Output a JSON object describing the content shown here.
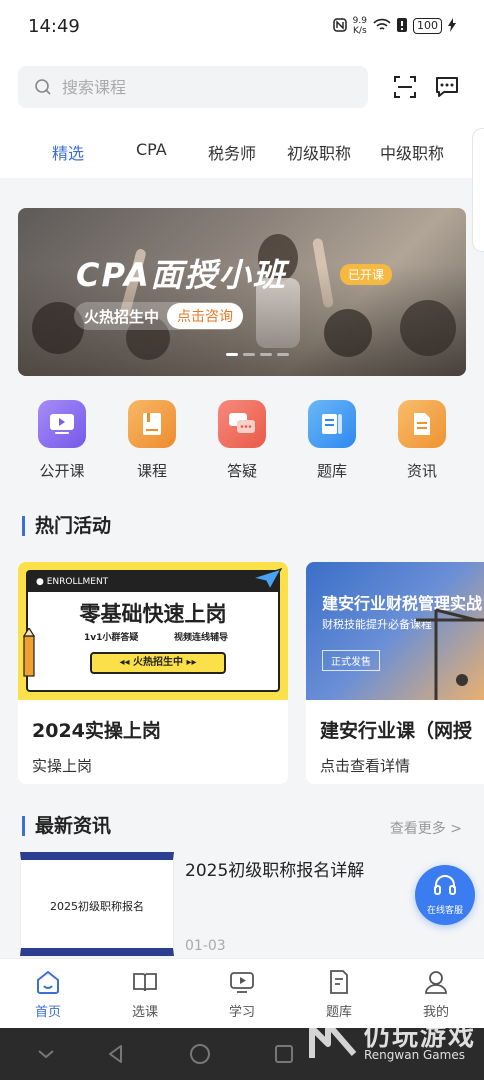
{
  "status": {
    "time": "14:49",
    "net_speed_value": "9.9",
    "net_speed_unit": "K/s",
    "battery": "100"
  },
  "search": {
    "placeholder": "搜索课程"
  },
  "tabs": [
    {
      "label": "精选",
      "active": true
    },
    {
      "label": "CPA"
    },
    {
      "label": "税务师"
    },
    {
      "label": "初级职称"
    },
    {
      "label": "中级职称"
    }
  ],
  "banner": {
    "title": "CPA面授小班",
    "tag": "已开课",
    "hot": "火热招生中",
    "cta": "点击咨询"
  },
  "quick": [
    {
      "label": "公开课",
      "icon": "play-icon",
      "color": "#8a6cf2"
    },
    {
      "label": "课程",
      "icon": "book-icon",
      "color": "#f2a040"
    },
    {
      "label": "答疑",
      "icon": "chat-icon",
      "color": "#f0685a"
    },
    {
      "label": "题库",
      "icon": "question-bank-icon",
      "color": "#3d9af0"
    },
    {
      "label": "资讯",
      "icon": "document-icon",
      "color": "#f2a040"
    }
  ],
  "hot_section": {
    "title": "热门活动"
  },
  "cards": [
    {
      "title": "2024实操上岗",
      "subtitle": "实操上岗",
      "img": {
        "badge": "● ENROLLMENT",
        "headline": "零基础快速上岗",
        "feat1": "1v1小群答疑",
        "feat2": "视频连线辅导",
        "pill": "◂◂ 火热招生中 ▸▸"
      }
    },
    {
      "title": "建安行业课（网授",
      "subtitle": "点击查看详情",
      "img": {
        "headline": "建安行业财税管理实战",
        "sub": "财税技能提升必备课程",
        "btn": "正式发售"
      }
    }
  ],
  "news_section": {
    "title": "最新资讯",
    "more": "查看更多 >"
  },
  "news": [
    {
      "title": "2025初级职称报名详解",
      "date": "01-03",
      "thumb_text": "2025初级职称报名"
    }
  ],
  "service": {
    "label": "在线客服"
  },
  "tabbar": [
    {
      "label": "首页",
      "active": true
    },
    {
      "label": "选课"
    },
    {
      "label": "学习"
    },
    {
      "label": "题库"
    },
    {
      "label": "我的"
    }
  ],
  "watermark": {
    "text": "仍玩游戏",
    "sub": "Rengwan Games"
  },
  "colors": {
    "accent": "#3b6fd4",
    "service": "#3b7cf0"
  }
}
